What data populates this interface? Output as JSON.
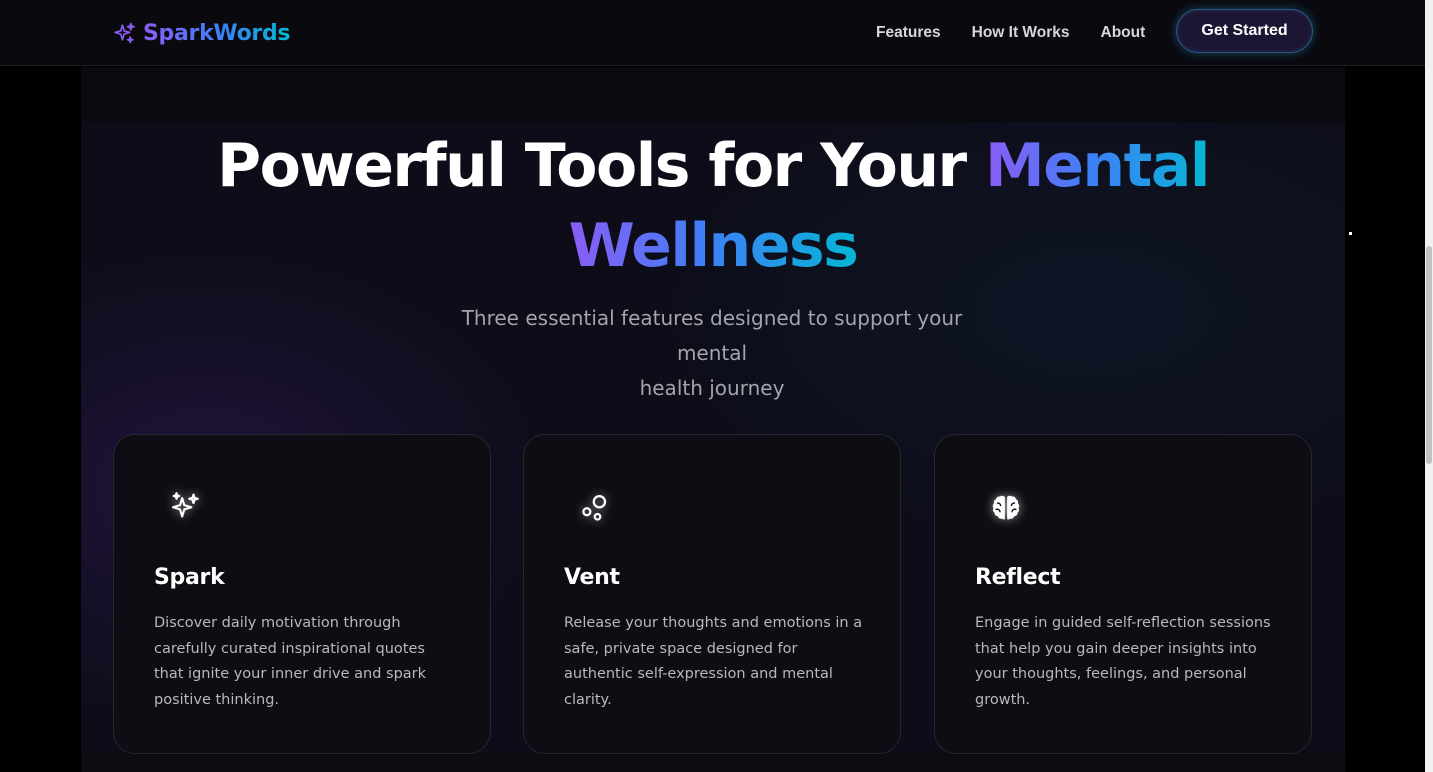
{
  "brand": {
    "name": "SparkWords",
    "icon": "sparkles-icon",
    "gradient": [
      "#8b5cf6",
      "#3b82f6",
      "#06b6d4"
    ]
  },
  "nav": {
    "links": [
      "Features",
      "How It Works",
      "About"
    ],
    "cta_label": "Get Started"
  },
  "hero": {
    "title_plain": "Powerful Tools for Your",
    "title_accent_1": "Mental",
    "title_accent_2": "Wellness",
    "subtitle_line1": "Three essential features designed to support your mental",
    "subtitle_line2": "health journey"
  },
  "features": [
    {
      "icon": "sparkles-icon",
      "title": "Spark",
      "description": "Discover daily motivation through carefully curated inspirational quotes that ignite your inner drive and spark positive thinking."
    },
    {
      "icon": "bubbles-icon",
      "title": "Vent",
      "description": "Release your thoughts and emotions in a safe, private space designed for authentic self-expression and mental clarity."
    },
    {
      "icon": "brain-icon",
      "title": "Reflect",
      "description": "Engage in guided self-reflection sessions that help you gain deeper insights into your thoughts, feelings, and personal growth."
    }
  ],
  "colors": {
    "background": "#000000",
    "card_border": "#262630",
    "text_muted": "#a3a4ad",
    "cta_glow": "#38bdf8"
  }
}
